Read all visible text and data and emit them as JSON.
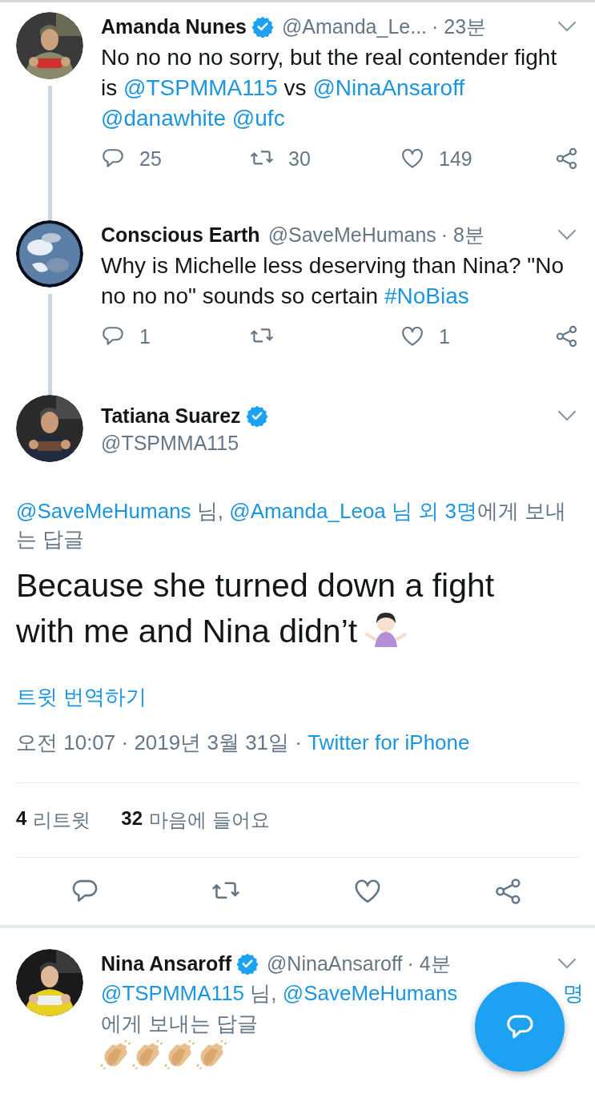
{
  "thread": [
    {
      "name": "Amanda Nunes",
      "verified": true,
      "handle": "@Amanda_Le...",
      "time": "· 23분",
      "body": [
        {
          "kind": "text",
          "text": "No no no no sorry, but the real contender fight is "
        },
        {
          "kind": "link",
          "text": "@TSPMMA115"
        },
        {
          "kind": "text",
          "text": "  vs "
        },
        {
          "kind": "link",
          "text": "@NinaAnsaroff",
          "space_after": true
        },
        {
          "kind": "link",
          "text": "@danawhite",
          "space_after": true
        },
        {
          "kind": "link",
          "text": "@ufc"
        }
      ],
      "replies": "25",
      "retweets": "30",
      "likes": "149"
    },
    {
      "name": "Conscious Earth",
      "verified": false,
      "handle": "@SaveMeHumans",
      "time": "· 8분",
      "body": [
        {
          "kind": "text",
          "text": "Why is Michelle less deserving than Nina? \"No no no no\" sounds so certain "
        },
        {
          "kind": "link",
          "text": "#NoBias"
        }
      ],
      "replies": "1",
      "likes": "1"
    }
  ],
  "focused": {
    "name": "Tatiana Suarez",
    "verified": true,
    "handle": "@TSPMMA115",
    "reply_to": [
      {
        "kind": "link",
        "text": "@SaveMeHumans"
      },
      {
        "kind": "text",
        "text": " 님, "
      },
      {
        "kind": "link",
        "text": "@Amanda_Leoa"
      },
      {
        "kind": "link",
        "text": " 님 외 3명"
      },
      {
        "kind": "text",
        "text": "에게 보내는 답글"
      }
    ],
    "text": "Because she turned down a fight with me and Nina didn’t",
    "translate": "트윗 번역하기",
    "timestamp": [
      {
        "kind": "text",
        "text": "오전 10:07 · 2019년 3월 31일 · "
      },
      {
        "kind": "link",
        "text": "Twitter for iPhone"
      }
    ],
    "stats": [
      {
        "count": "4",
        "label": "리트윗"
      },
      {
        "count": "32",
        "label": "마음에 들어요"
      }
    ]
  },
  "replies": [
    {
      "name": "Nina Ansaroff",
      "verified": true,
      "handle": "@NinaAnsaroff",
      "time": "· 4분",
      "reply_lines": [
        [
          {
            "kind": "link",
            "text": "@TSPMMA115"
          },
          {
            "kind": "text",
            "text": " 님, "
          },
          {
            "kind": "link",
            "text": "@SaveMeHumans"
          },
          {
            "kind": "link",
            "text": "명",
            "at_end": true
          }
        ],
        [
          {
            "kind": "text",
            "text": "에게 보내는 답글"
          }
        ]
      ]
    }
  ]
}
